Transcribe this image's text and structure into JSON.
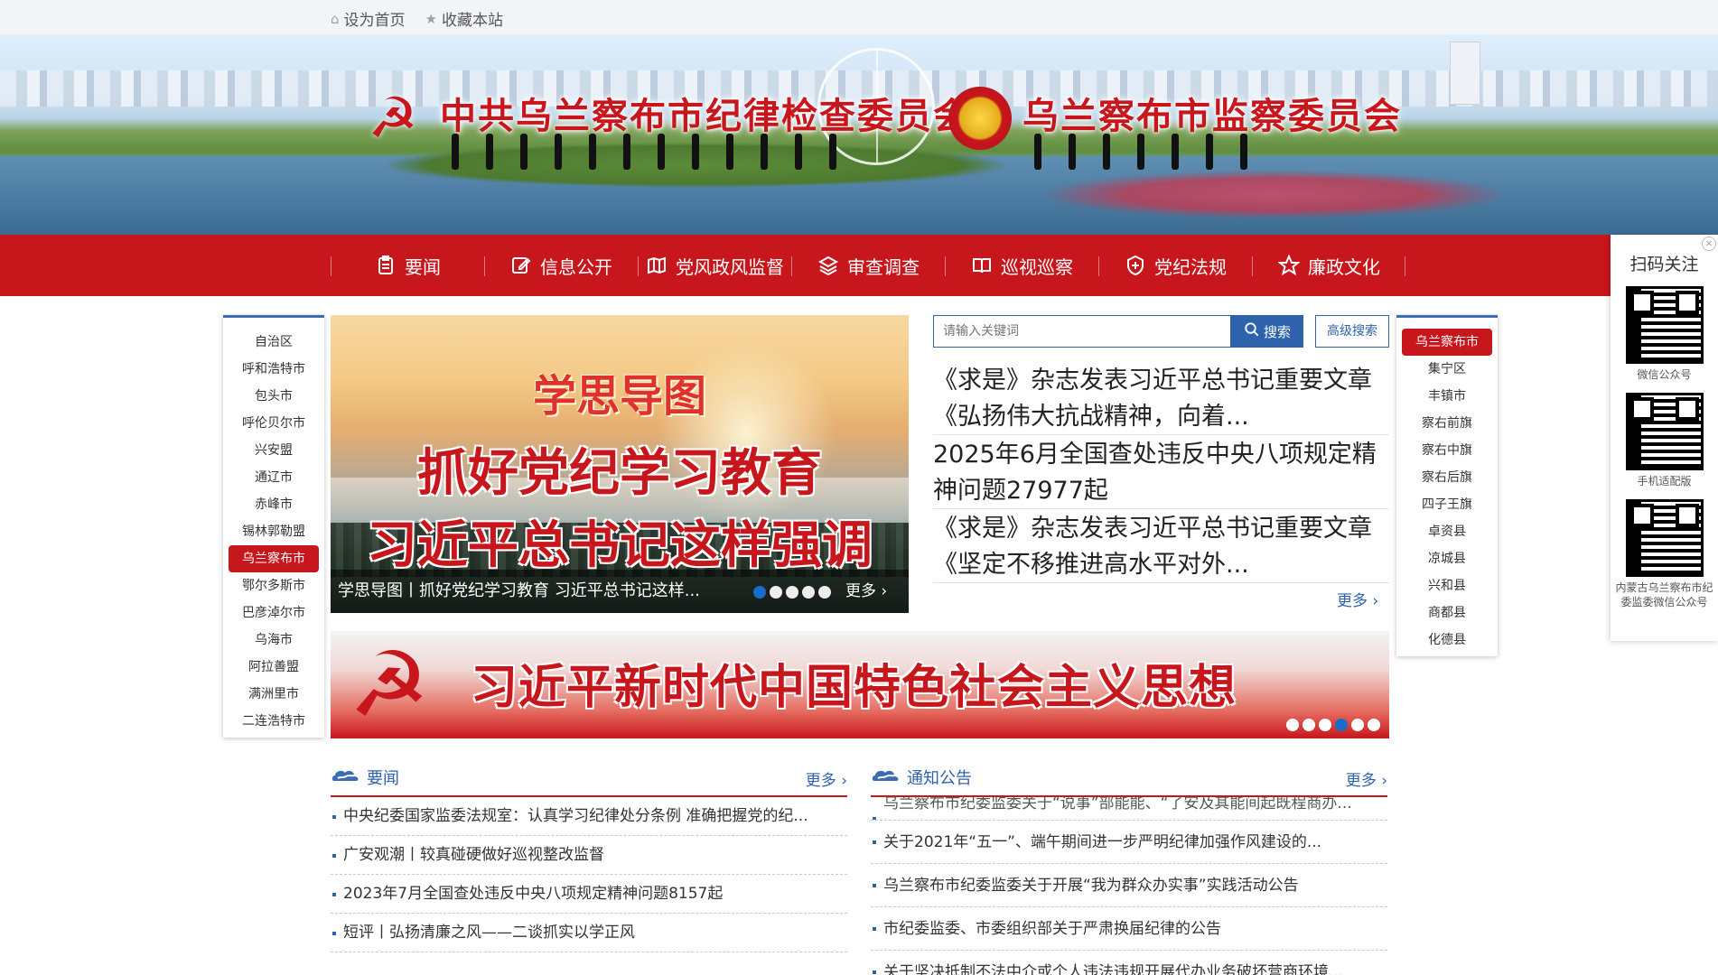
{
  "topbar": {
    "set_home": "设为首页",
    "bookmark": "收藏本站"
  },
  "banner": {
    "title_left": "中共乌兰察布市纪律检查委员会",
    "title_right": "乌兰察布市监察委员会"
  },
  "nav": {
    "items": [
      {
        "label": "要闻",
        "icon": "document-icon"
      },
      {
        "label": "信息公开",
        "icon": "edit-icon"
      },
      {
        "label": "党风政风监督",
        "icon": "map-icon"
      },
      {
        "label": "审查调查",
        "icon": "layers-icon"
      },
      {
        "label": "巡视巡察",
        "icon": "book-icon"
      },
      {
        "label": "党纪法规",
        "icon": "shield-icon"
      },
      {
        "label": "廉政文化",
        "icon": "star-icon"
      }
    ]
  },
  "regions_left": [
    "自治区",
    "呼和浩特市",
    "包头市",
    "呼伦贝尔市",
    "兴安盟",
    "通辽市",
    "赤峰市",
    "锡林郭勒盟",
    "乌兰察布市",
    "鄂尔多斯市",
    "巴彦淖尔市",
    "乌海市",
    "阿拉善盟",
    "满洲里市",
    "二连浩特市"
  ],
  "regions_left_active": 8,
  "regions_right": [
    "乌兰察布市",
    "集宁区",
    "丰镇市",
    "察右前旗",
    "察右中旗",
    "察右后旗",
    "四子王旗",
    "卓资县",
    "凉城县",
    "兴和县",
    "商都县",
    "化德县"
  ],
  "regions_right_active": 0,
  "slider": {
    "line1": "学思导图",
    "line2": "抓好党纪学习教育",
    "line3": "习近平总书记这样强调",
    "caption": "学思导图丨抓好党纪学习教育 习近平总书记这样...",
    "more": "更多",
    "dots": 5,
    "active_dot": 0
  },
  "search": {
    "placeholder": "请输入关键词",
    "button": "搜索",
    "advanced": "高级搜索"
  },
  "hot_news": [
    "《求是》杂志发表习近平总书记重要文章《弘扬伟大抗战精神，向着...",
    "2025年6月全国查处违反中央八项规定精神问题27977起",
    "《求是》杂志发表习近平总书记重要文章《坚定不移推进高水平对外..."
  ],
  "hot_more": "更多",
  "big_banner": {
    "text": "习近平新时代中国特色社会主义思想",
    "dots": 6,
    "active_dot": 3
  },
  "sections": {
    "news": {
      "title": "要闻",
      "more": "更多",
      "items": [
        "中央纪委国家监委法规室：认真学习纪律处分条例 准确把握党的纪...",
        "广安观潮丨较真碰硬做好巡视整改监督",
        "2023年7月全国查处违反中央八项规定精神问题8157起",
        "短评丨弘扬清廉之风——二谈抓实以学正风"
      ]
    },
    "notice": {
      "title": "通知公告",
      "more": "更多",
      "cut_item": "乌兰察布市纪委监委关于“说事”部能能、“了安及其能间起既程商办...",
      "items": [
        "关于2021年“五一”、端午期间进一步严明纪律加强作风建设的...",
        "乌兰察布市纪委监委关于开展“我为群众办实事”实践活动公告",
        "市纪委监委、市委组织部关于严肃换届纪律的公告",
        "关于坚决抵制不法中介或个人违法违规开展代办业务破坏营商环境..."
      ]
    }
  },
  "qr_panel": {
    "title": "扫码关注",
    "codes": [
      "微信公众号",
      "手机适配版",
      "内蒙古乌兰察布市纪委监委微信公众号"
    ]
  }
}
